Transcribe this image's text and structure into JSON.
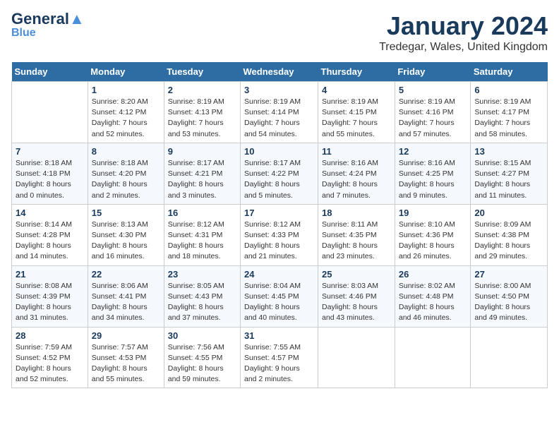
{
  "header": {
    "logo_general": "General",
    "logo_blue": "Blue",
    "month_title": "January 2024",
    "location": "Tredegar, Wales, United Kingdom"
  },
  "days_of_week": [
    "Sunday",
    "Monday",
    "Tuesday",
    "Wednesday",
    "Thursday",
    "Friday",
    "Saturday"
  ],
  "weeks": [
    [
      {
        "day": "",
        "sunrise": "",
        "sunset": "",
        "daylight": ""
      },
      {
        "day": "1",
        "sunrise": "Sunrise: 8:20 AM",
        "sunset": "Sunset: 4:12 PM",
        "daylight": "Daylight: 7 hours and 52 minutes."
      },
      {
        "day": "2",
        "sunrise": "Sunrise: 8:19 AM",
        "sunset": "Sunset: 4:13 PM",
        "daylight": "Daylight: 7 hours and 53 minutes."
      },
      {
        "day": "3",
        "sunrise": "Sunrise: 8:19 AM",
        "sunset": "Sunset: 4:14 PM",
        "daylight": "Daylight: 7 hours and 54 minutes."
      },
      {
        "day": "4",
        "sunrise": "Sunrise: 8:19 AM",
        "sunset": "Sunset: 4:15 PM",
        "daylight": "Daylight: 7 hours and 55 minutes."
      },
      {
        "day": "5",
        "sunrise": "Sunrise: 8:19 AM",
        "sunset": "Sunset: 4:16 PM",
        "daylight": "Daylight: 7 hours and 57 minutes."
      },
      {
        "day": "6",
        "sunrise": "Sunrise: 8:19 AM",
        "sunset": "Sunset: 4:17 PM",
        "daylight": "Daylight: 7 hours and 58 minutes."
      }
    ],
    [
      {
        "day": "7",
        "sunrise": "Sunrise: 8:18 AM",
        "sunset": "Sunset: 4:18 PM",
        "daylight": "Daylight: 8 hours and 0 minutes."
      },
      {
        "day": "8",
        "sunrise": "Sunrise: 8:18 AM",
        "sunset": "Sunset: 4:20 PM",
        "daylight": "Daylight: 8 hours and 2 minutes."
      },
      {
        "day": "9",
        "sunrise": "Sunrise: 8:17 AM",
        "sunset": "Sunset: 4:21 PM",
        "daylight": "Daylight: 8 hours and 3 minutes."
      },
      {
        "day": "10",
        "sunrise": "Sunrise: 8:17 AM",
        "sunset": "Sunset: 4:22 PM",
        "daylight": "Daylight: 8 hours and 5 minutes."
      },
      {
        "day": "11",
        "sunrise": "Sunrise: 8:16 AM",
        "sunset": "Sunset: 4:24 PM",
        "daylight": "Daylight: 8 hours and 7 minutes."
      },
      {
        "day": "12",
        "sunrise": "Sunrise: 8:16 AM",
        "sunset": "Sunset: 4:25 PM",
        "daylight": "Daylight: 8 hours and 9 minutes."
      },
      {
        "day": "13",
        "sunrise": "Sunrise: 8:15 AM",
        "sunset": "Sunset: 4:27 PM",
        "daylight": "Daylight: 8 hours and 11 minutes."
      }
    ],
    [
      {
        "day": "14",
        "sunrise": "Sunrise: 8:14 AM",
        "sunset": "Sunset: 4:28 PM",
        "daylight": "Daylight: 8 hours and 14 minutes."
      },
      {
        "day": "15",
        "sunrise": "Sunrise: 8:13 AM",
        "sunset": "Sunset: 4:30 PM",
        "daylight": "Daylight: 8 hours and 16 minutes."
      },
      {
        "day": "16",
        "sunrise": "Sunrise: 8:12 AM",
        "sunset": "Sunset: 4:31 PM",
        "daylight": "Daylight: 8 hours and 18 minutes."
      },
      {
        "day": "17",
        "sunrise": "Sunrise: 8:12 AM",
        "sunset": "Sunset: 4:33 PM",
        "daylight": "Daylight: 8 hours and 21 minutes."
      },
      {
        "day": "18",
        "sunrise": "Sunrise: 8:11 AM",
        "sunset": "Sunset: 4:35 PM",
        "daylight": "Daylight: 8 hours and 23 minutes."
      },
      {
        "day": "19",
        "sunrise": "Sunrise: 8:10 AM",
        "sunset": "Sunset: 4:36 PM",
        "daylight": "Daylight: 8 hours and 26 minutes."
      },
      {
        "day": "20",
        "sunrise": "Sunrise: 8:09 AM",
        "sunset": "Sunset: 4:38 PM",
        "daylight": "Daylight: 8 hours and 29 minutes."
      }
    ],
    [
      {
        "day": "21",
        "sunrise": "Sunrise: 8:08 AM",
        "sunset": "Sunset: 4:39 PM",
        "daylight": "Daylight: 8 hours and 31 minutes."
      },
      {
        "day": "22",
        "sunrise": "Sunrise: 8:06 AM",
        "sunset": "Sunset: 4:41 PM",
        "daylight": "Daylight: 8 hours and 34 minutes."
      },
      {
        "day": "23",
        "sunrise": "Sunrise: 8:05 AM",
        "sunset": "Sunset: 4:43 PM",
        "daylight": "Daylight: 8 hours and 37 minutes."
      },
      {
        "day": "24",
        "sunrise": "Sunrise: 8:04 AM",
        "sunset": "Sunset: 4:45 PM",
        "daylight": "Daylight: 8 hours and 40 minutes."
      },
      {
        "day": "25",
        "sunrise": "Sunrise: 8:03 AM",
        "sunset": "Sunset: 4:46 PM",
        "daylight": "Daylight: 8 hours and 43 minutes."
      },
      {
        "day": "26",
        "sunrise": "Sunrise: 8:02 AM",
        "sunset": "Sunset: 4:48 PM",
        "daylight": "Daylight: 8 hours and 46 minutes."
      },
      {
        "day": "27",
        "sunrise": "Sunrise: 8:00 AM",
        "sunset": "Sunset: 4:50 PM",
        "daylight": "Daylight: 8 hours and 49 minutes."
      }
    ],
    [
      {
        "day": "28",
        "sunrise": "Sunrise: 7:59 AM",
        "sunset": "Sunset: 4:52 PM",
        "daylight": "Daylight: 8 hours and 52 minutes."
      },
      {
        "day": "29",
        "sunrise": "Sunrise: 7:57 AM",
        "sunset": "Sunset: 4:53 PM",
        "daylight": "Daylight: 8 hours and 55 minutes."
      },
      {
        "day": "30",
        "sunrise": "Sunrise: 7:56 AM",
        "sunset": "Sunset: 4:55 PM",
        "daylight": "Daylight: 8 hours and 59 minutes."
      },
      {
        "day": "31",
        "sunrise": "Sunrise: 7:55 AM",
        "sunset": "Sunset: 4:57 PM",
        "daylight": "Daylight: 9 hours and 2 minutes."
      },
      {
        "day": "",
        "sunrise": "",
        "sunset": "",
        "daylight": ""
      },
      {
        "day": "",
        "sunrise": "",
        "sunset": "",
        "daylight": ""
      },
      {
        "day": "",
        "sunrise": "",
        "sunset": "",
        "daylight": ""
      }
    ]
  ]
}
